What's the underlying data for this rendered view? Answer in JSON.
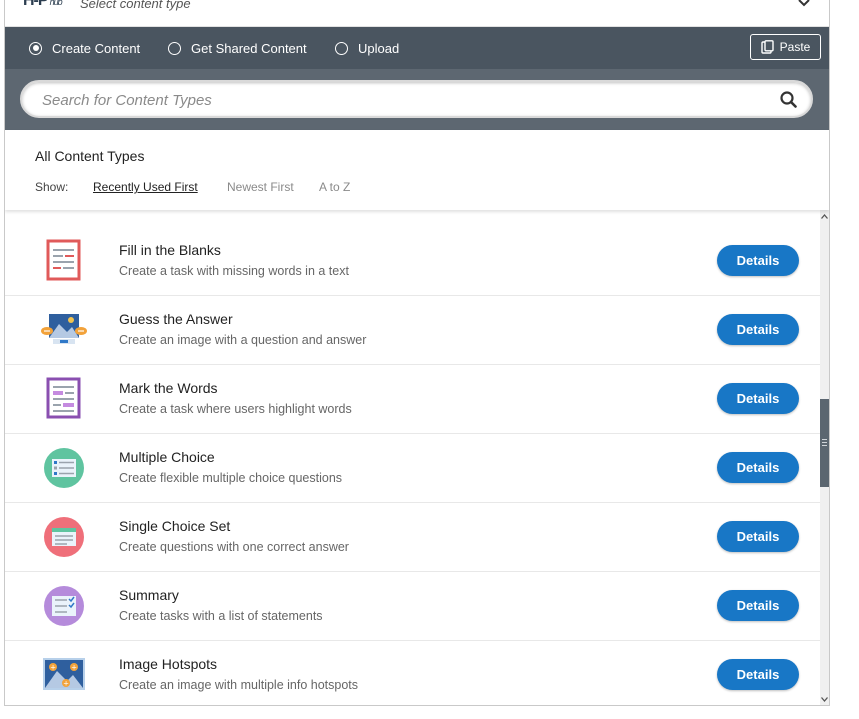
{
  "header": {
    "logo_text": "H-P",
    "logo_sub": "hub",
    "select_label": "Select content type"
  },
  "nav": {
    "tabs": [
      {
        "label": "Create Content",
        "selected": true
      },
      {
        "label": "Get Shared Content",
        "selected": false
      },
      {
        "label": "Upload",
        "selected": false
      }
    ],
    "paste_label": "Paste"
  },
  "search": {
    "placeholder": "Search for Content Types",
    "value": ""
  },
  "filters": {
    "heading": "All Content Types",
    "show_label": "Show:",
    "sort_options": [
      {
        "label": "Recently Used First",
        "active": true
      },
      {
        "label": "Newest First",
        "active": false
      },
      {
        "label": "A to Z",
        "active": false
      }
    ]
  },
  "items": [
    {
      "title": "Fill in the Blanks",
      "description": "Create a task with missing words in a text",
      "button": "Details",
      "icon": "fill-blanks-icon"
    },
    {
      "title": "Guess the Answer",
      "description": "Create an image with a question and answer",
      "button": "Details",
      "icon": "guess-answer-icon"
    },
    {
      "title": "Mark the Words",
      "description": "Create a task where users highlight words",
      "button": "Details",
      "icon": "mark-words-icon"
    },
    {
      "title": "Multiple Choice",
      "description": "Create flexible multiple choice questions",
      "button": "Details",
      "icon": "multiple-choice-icon"
    },
    {
      "title": "Single Choice Set",
      "description": "Create questions with one correct answer",
      "button": "Details",
      "icon": "single-choice-icon"
    },
    {
      "title": "Summary",
      "description": "Create tasks with a list of statements",
      "button": "Details",
      "icon": "summary-icon"
    },
    {
      "title": "Image Hotspots",
      "description": "Create an image with multiple info hotspots",
      "button": "Details",
      "icon": "image-hotspots-icon"
    }
  ],
  "colors": {
    "nav_bg": "#4a5560",
    "search_bg": "#5d6771",
    "accent": "#1877c6"
  }
}
